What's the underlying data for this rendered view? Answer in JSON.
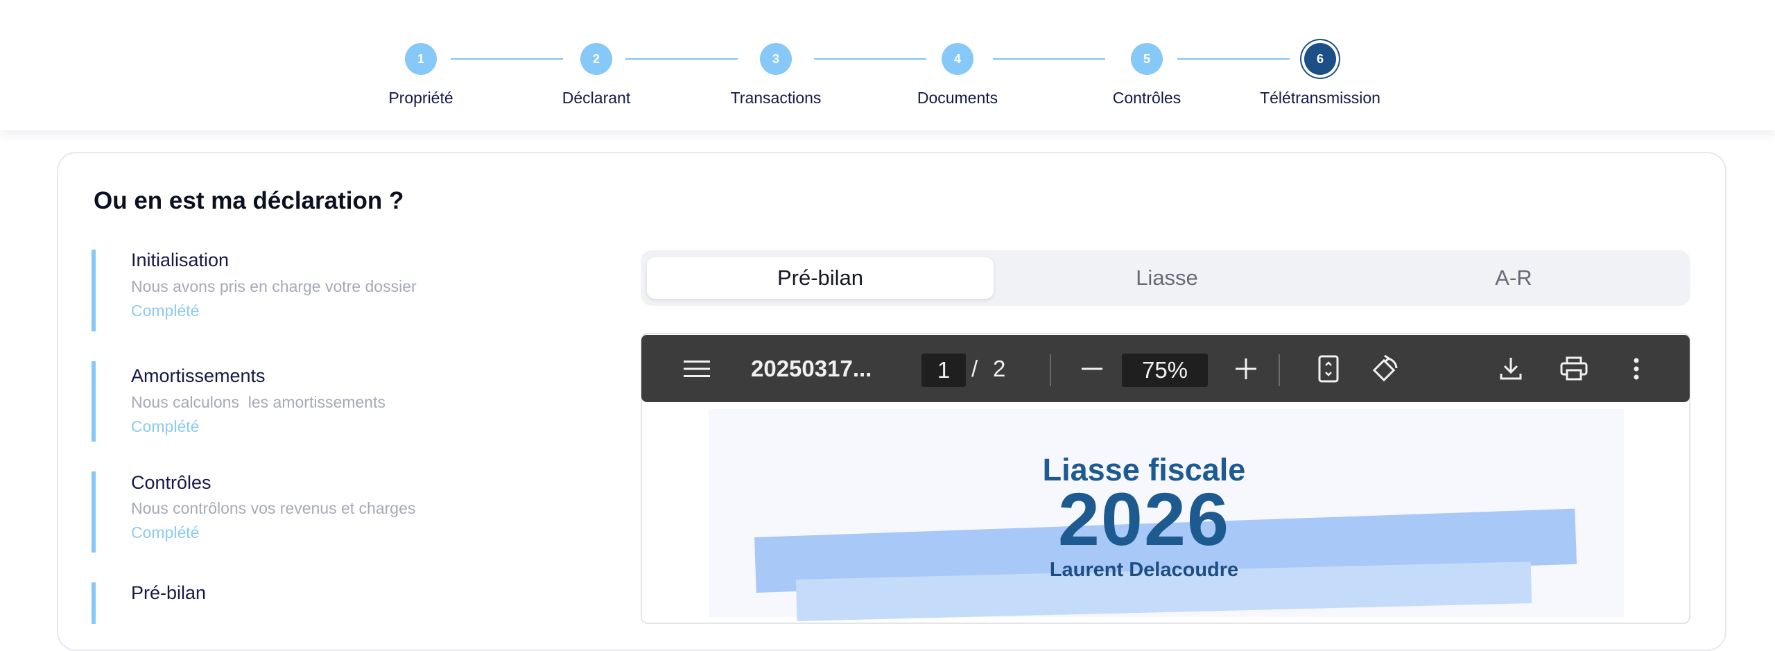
{
  "stepper": {
    "steps": [
      {
        "number": "1",
        "label": "Propriété"
      },
      {
        "number": "2",
        "label": "Déclarant"
      },
      {
        "number": "3",
        "label": "Transactions"
      },
      {
        "number": "4",
        "label": "Documents"
      },
      {
        "number": "5",
        "label": "Contrôles"
      },
      {
        "number": "6",
        "label": "Télétransmission"
      }
    ],
    "active_step": 6,
    "colors": {
      "done": "#86c8f7",
      "active": "#1b4f85",
      "line": "#7ec3f2"
    }
  },
  "card": {
    "title": "Ou en est ma déclaration ?"
  },
  "timeline": {
    "items": [
      {
        "title": "Initialisation",
        "description": "Nous avons pris en charge votre dossier",
        "status": "Complété"
      },
      {
        "title": "Amortissements",
        "description": "Nous calculons  les amortissements",
        "status": "Complété"
      },
      {
        "title": "Contrôles",
        "description": "Nous contrôlons vos revenus et charges",
        "status": "Complété"
      },
      {
        "title": "Pré-bilan"
      }
    ],
    "colors": {
      "bar": "#86c8f7",
      "status": "#8ccaf3"
    }
  },
  "tabs": {
    "items": [
      "Pré-bilan",
      "Liasse",
      "A-R"
    ],
    "active": "Pré-bilan"
  },
  "pdf_viewer": {
    "menu_icon": "menu-icon",
    "file_name": "20250317...",
    "current_page": "1",
    "page_separator": "/",
    "total_pages": "2",
    "zoom": "75%",
    "icons": [
      "minus-icon",
      "plus-icon",
      "fit-page-icon",
      "rotate-icon",
      "download-icon",
      "print-icon",
      "more-vert-icon"
    ]
  },
  "document": {
    "title": "Liasse fiscale",
    "year": "2026",
    "name": "Laurent Delacoudre"
  }
}
